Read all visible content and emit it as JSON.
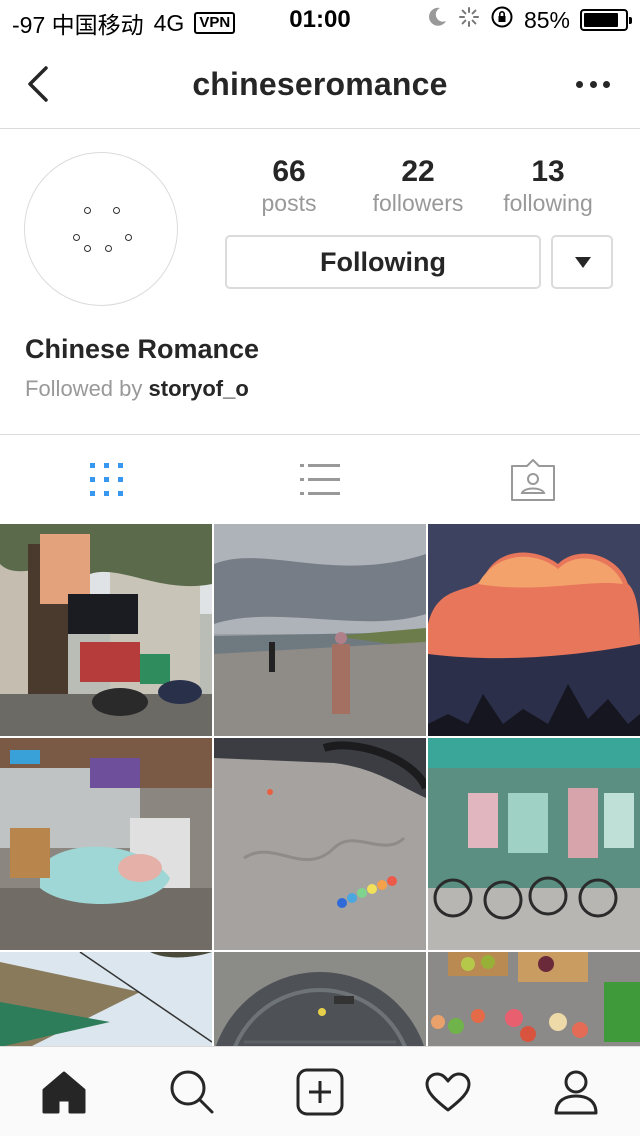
{
  "status_bar": {
    "carrier": "-97 中国移动",
    "network": "4G",
    "vpn": "VPN",
    "time": "01:00",
    "battery": "85%",
    "battery_level": 0.85
  },
  "header": {
    "title": "chineseromance"
  },
  "profile": {
    "name": "Chinese Romance",
    "followed_by_prefix": "Followed by",
    "followed_by_user": "storyof_o",
    "stats": [
      {
        "value": "66",
        "label": "posts"
      },
      {
        "value": "22",
        "label": "followers"
      },
      {
        "value": "13",
        "label": "following"
      }
    ],
    "following_button": "Following"
  },
  "tabs": [
    {
      "icon": "grid-view-icon",
      "active": true
    },
    {
      "icon": "list-view-icon",
      "active": false
    },
    {
      "icon": "tagged-photos-icon",
      "active": false
    }
  ],
  "colors": {
    "active_tab": "#3897f0",
    "inactive_icon": "#999999",
    "border": "#dbdbdb",
    "muted_text": "#999999"
  },
  "bottom_nav": [
    {
      "icon": "home-icon",
      "active": true
    },
    {
      "icon": "search-icon",
      "active": false
    },
    {
      "icon": "add-post-icon",
      "active": false
    },
    {
      "icon": "activity-heart-icon",
      "active": false
    },
    {
      "icon": "profile-icon",
      "active": false
    }
  ]
}
